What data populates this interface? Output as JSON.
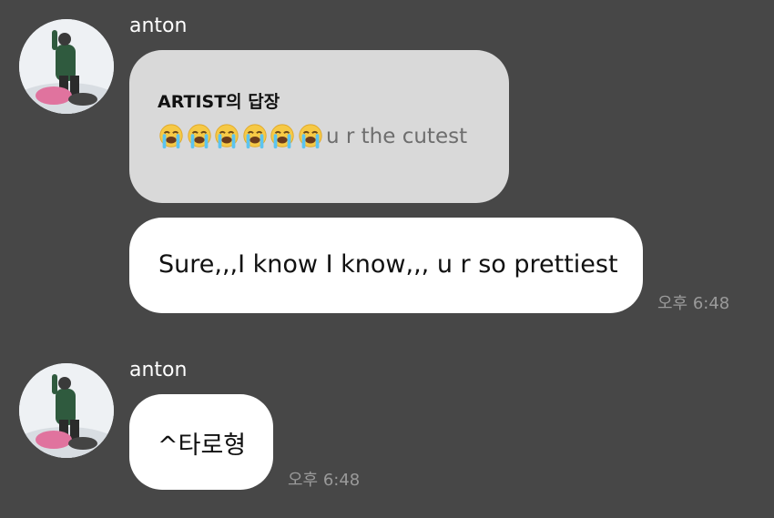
{
  "messages": [
    {
      "sender": "anton",
      "reply": {
        "title": "ARTIST의 답장",
        "emoji_icon": "loudly-crying-face-icon",
        "emoji_count": 6,
        "text": "u r the cutest"
      },
      "text": "Sure,,,I know I know,,, u r so prettiest",
      "time": "오후 6:48"
    },
    {
      "sender": "anton",
      "text": "^타로형",
      "time": "오후 6:48"
    }
  ],
  "colors": {
    "background": "#474747",
    "bubble_white": "#ffffff",
    "bubble_gray": "#d9d9d9",
    "time_text": "#9a9a9a"
  }
}
